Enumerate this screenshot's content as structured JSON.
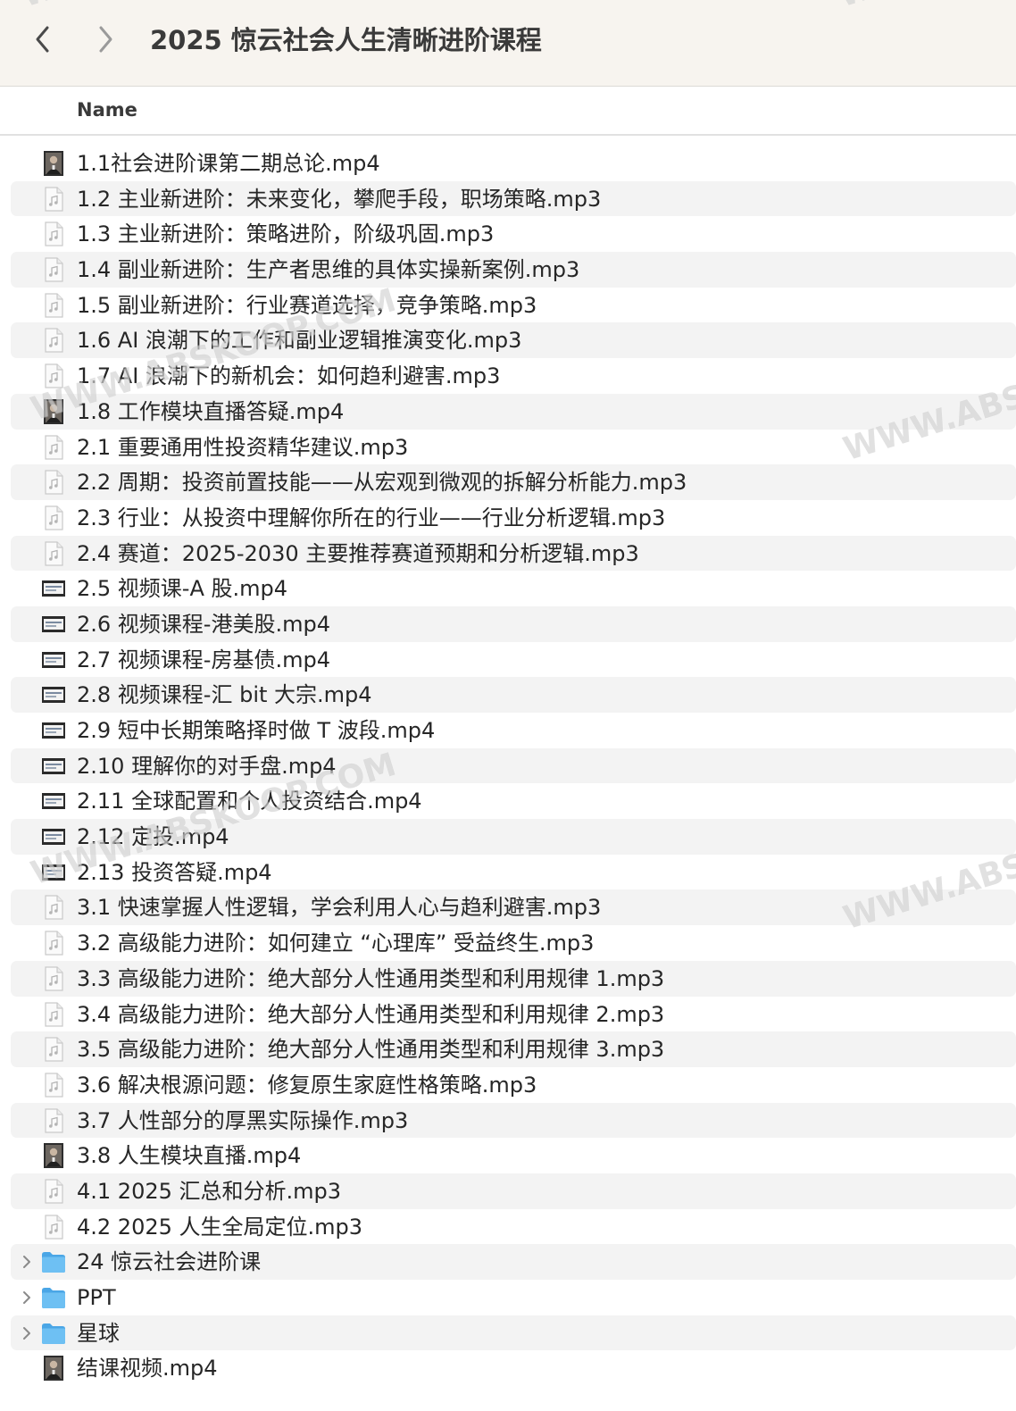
{
  "toolbar": {
    "title": "2025 惊云社会人生清晰进阶课程",
    "back_icon": "chevron-left-icon",
    "forward_icon": "chevron-right-icon"
  },
  "header": {
    "name_column": "Name"
  },
  "colors": {
    "toolbar_bg": "#f7f4ef",
    "stripe": "#f3f3f3",
    "folder": "#5bb4ee"
  },
  "files": [
    {
      "name": "1.1社会进阶课第二期总论.mp4",
      "icon": "video-portrait-icon"
    },
    {
      "name": "1.2 主业新进阶：未来变化，攀爬手段，职场策略.mp3",
      "icon": "audio-file-icon"
    },
    {
      "name": "1.3 主业新进阶：策略进阶，阶级巩固.mp3",
      "icon": "audio-file-icon"
    },
    {
      "name": "1.4 副业新进阶：生产者思维的具体实操新案例.mp3",
      "icon": "audio-file-icon"
    },
    {
      "name": "1.5 副业新进阶：行业赛道选择，竞争策略.mp3",
      "icon": "audio-file-icon"
    },
    {
      "name": "1.6 AI 浪潮下的工作和副业逻辑推演变化.mp3",
      "icon": "audio-file-icon"
    },
    {
      "name": "1.7 AI 浪潮下的新机会：如何趋利避害.mp3",
      "icon": "audio-file-icon"
    },
    {
      "name": "1.8 工作模块直播答疑.mp4",
      "icon": "video-portrait-icon"
    },
    {
      "name": "2.1 重要通用性投资精华建议.mp3",
      "icon": "audio-file-icon"
    },
    {
      "name": "2.2 周期：投资前置技能——从宏观到微观的拆解分析能力.mp3",
      "icon": "audio-file-icon"
    },
    {
      "name": "2.3 行业：从投资中理解你所在的行业——行业分析逻辑.mp3",
      "icon": "audio-file-icon"
    },
    {
      "name": "2.4 赛道：2025-2030 主要推荐赛道预期和分析逻辑.mp3",
      "icon": "audio-file-icon"
    },
    {
      "name": "2.5 视频课-A 股.mp4",
      "icon": "video-slide-icon"
    },
    {
      "name": "2.6 视频课程-港美股.mp4",
      "icon": "video-slide-icon"
    },
    {
      "name": "2.7 视频课程-房基债.mp4",
      "icon": "video-slide-icon"
    },
    {
      "name": "2.8 视频课程-汇 bit 大宗.mp4",
      "icon": "video-slide-icon"
    },
    {
      "name": "2.9 短中长期策略择时做 T 波段.mp4",
      "icon": "video-slide-icon"
    },
    {
      "name": "2.10 理解你的对手盘.mp4",
      "icon": "video-slide-icon"
    },
    {
      "name": "2.11 全球配置和个人投资结合.mp4",
      "icon": "video-slide-icon"
    },
    {
      "name": "2.12 定投.mp4",
      "icon": "video-slide-icon"
    },
    {
      "name": "2.13 投资答疑.mp4",
      "icon": "video-slide-icon"
    },
    {
      "name": "3.1 快速掌握人性逻辑，学会利用人心与趋利避害.mp3",
      "icon": "audio-file-icon"
    },
    {
      "name": "3.2 高级能力进阶：如何建立 “心理库” 受益终生.mp3",
      "icon": "audio-file-icon"
    },
    {
      "name": "3.3 高级能力进阶：绝大部分人性通用类型和利用规律 1.mp3",
      "icon": "audio-file-icon"
    },
    {
      "name": "3.4 高级能力进阶：绝大部分人性通用类型和利用规律 2.mp3",
      "icon": "audio-file-icon"
    },
    {
      "name": "3.5 高级能力进阶：绝大部分人性通用类型和利用规律 3.mp3",
      "icon": "audio-file-icon"
    },
    {
      "name": "3.6 解决根源问题：修复原生家庭性格策略.mp3",
      "icon": "audio-file-icon"
    },
    {
      "name": "3.7 人性部分的厚黑实际操作.mp3",
      "icon": "audio-file-icon"
    },
    {
      "name": "3.8 人生模块直播.mp4",
      "icon": "video-portrait-icon"
    },
    {
      "name": "4.1 2025 汇总和分析.mp3",
      "icon": "audio-file-icon"
    },
    {
      "name": "4.2 2025 人生全局定位.mp3",
      "icon": "audio-file-icon"
    },
    {
      "name": "24 惊云社会进阶课",
      "icon": "folder-icon",
      "folder": true
    },
    {
      "name": "PPT",
      "icon": "folder-icon",
      "folder": true
    },
    {
      "name": "星球",
      "icon": "folder-icon",
      "folder": true
    },
    {
      "name": "结课视频.mp4",
      "icon": "video-portrait-icon"
    }
  ],
  "watermarks": [
    "WWW.ABSKOOP.COM",
    "WWW.ABSKOOP.COM",
    "WWW.ABSKOOP.COM",
    "WWW.ABSKOOP.COM",
    "WWW.ABSKOOP.COM",
    "WWW.ABSKOOP.COM"
  ]
}
